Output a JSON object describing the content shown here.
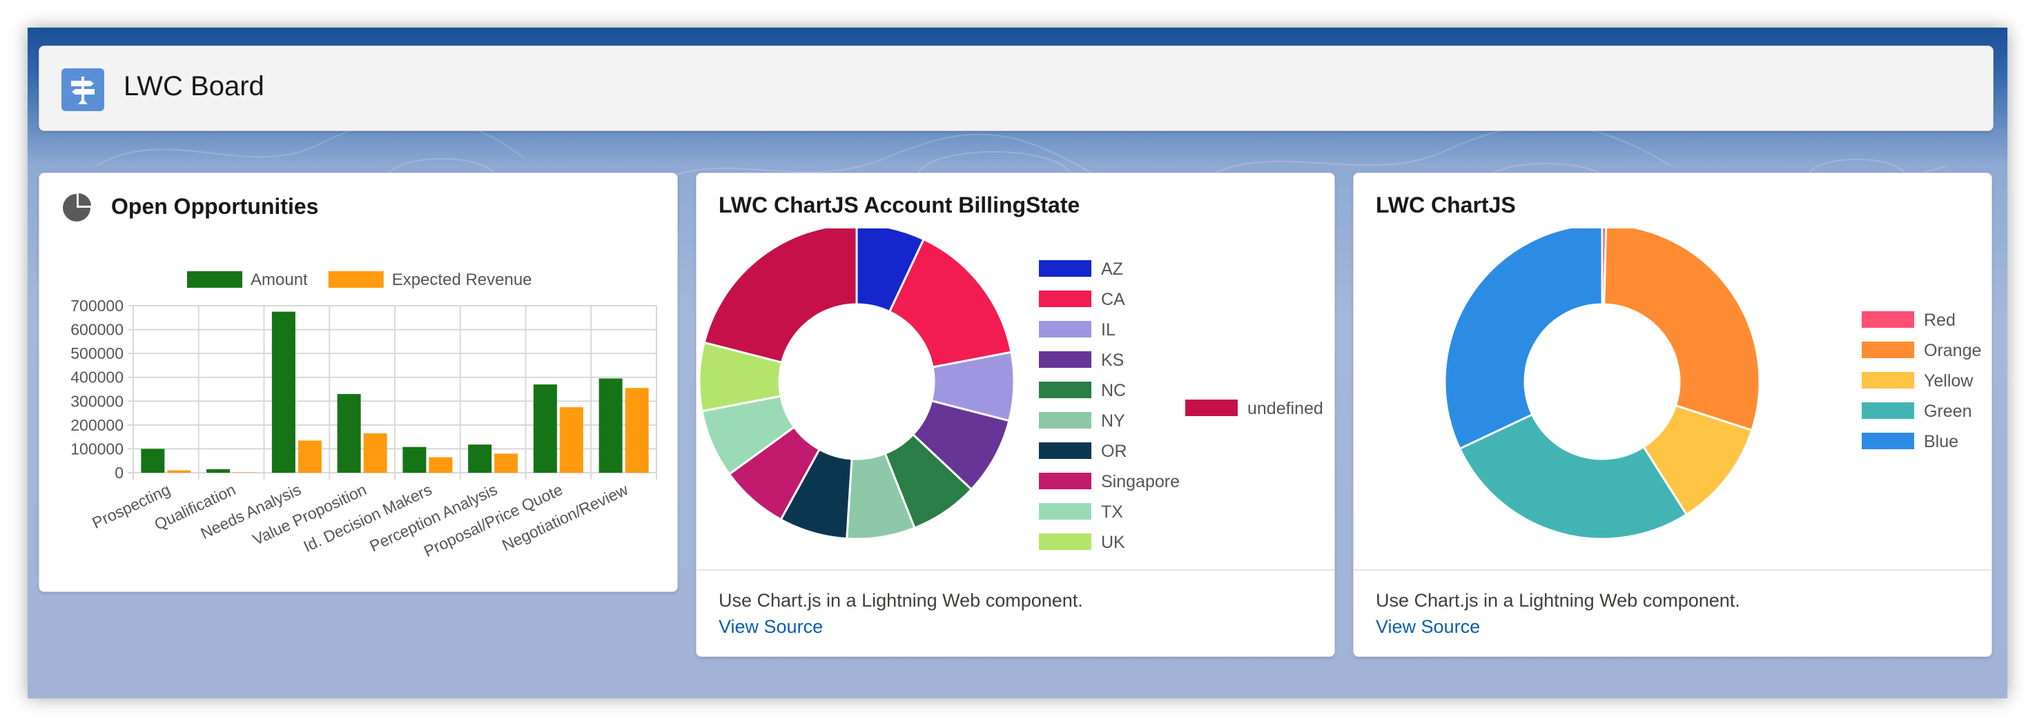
{
  "header": {
    "title": "LWC Board",
    "icon": "signpost-icon",
    "icon_color": "#5a8fd8"
  },
  "cards": {
    "opportunities": {
      "title": "Open Opportunities",
      "icon": "pie-chart-icon"
    },
    "billing": {
      "title": "LWC ChartJS Account BillingState",
      "footer_text": "Use Chart.js in a Lightning Web component.",
      "footer_link": "View Source"
    },
    "chartjs": {
      "title": "LWC ChartJS",
      "footer_text": "Use Chart.js in a Lightning Web component.",
      "footer_link": "View Source"
    }
  },
  "chart_data": [
    {
      "type": "bar",
      "title": "",
      "categories": [
        "Prospecting",
        "Qualification",
        "Needs Analysis",
        "Value Proposition",
        "Id. Decision Makers",
        "Perception Analysis",
        "Proposal/Price Quote",
        "Negotiation/Review"
      ],
      "series": [
        {
          "name": "Amount",
          "color": "#157415",
          "values": [
            100000,
            15000,
            675000,
            330000,
            108000,
            118000,
            370000,
            395000
          ]
        },
        {
          "name": "Expected Revenue",
          "color": "#ff9a0e",
          "values": [
            10000,
            1500,
            135000,
            165000,
            65000,
            80000,
            275000,
            355000
          ]
        }
      ],
      "ylim": [
        0,
        700000
      ],
      "yticks": [
        "700000",
        "600000",
        "500000",
        "400000",
        "300000",
        "200000",
        "100000",
        "0"
      ],
      "grid": true,
      "legend": "top"
    },
    {
      "type": "pie",
      "donut": true,
      "title": "",
      "labels": [
        "AZ",
        "CA",
        "IL",
        "KS",
        "NC",
        "NY",
        "OR",
        "Singapore",
        "TX",
        "UK",
        "undefined"
      ],
      "values": [
        7,
        15,
        7,
        8,
        7,
        7,
        7,
        7,
        7,
        7,
        21
      ],
      "colors": [
        "#1426cc",
        "#f21c50",
        "#9f96e0",
        "#673596",
        "#2a7d45",
        "#8dc9a8",
        "#0b3650",
        "#c21a6e",
        "#9adbb6",
        "#b4e46c",
        "#c6104a"
      ],
      "legend": "right"
    },
    {
      "type": "pie",
      "donut": true,
      "title": "",
      "labels": [
        "Red",
        "Orange",
        "Yellow",
        "Green",
        "Blue"
      ],
      "values": [
        0.4,
        29.6,
        11,
        27,
        32
      ],
      "colors": [
        "#ff4f72",
        "#ff8c32",
        "#ffc444",
        "#43b4b4",
        "#2c8ce4"
      ],
      "legend": "right"
    }
  ]
}
